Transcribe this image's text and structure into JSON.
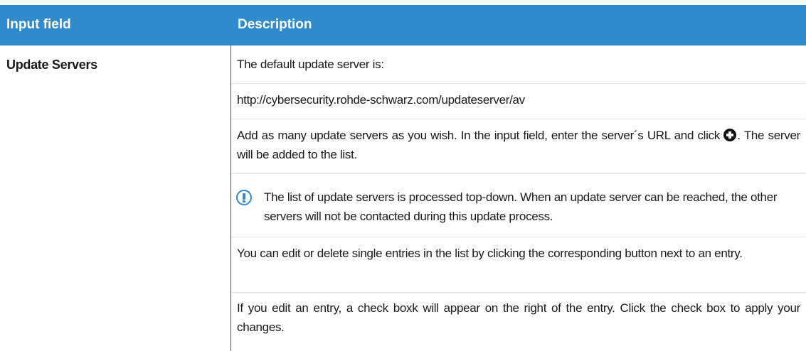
{
  "table": {
    "headers": {
      "input_field": "Input field",
      "description": "Description"
    },
    "row": {
      "label": "Update Servers",
      "paragraphs": {
        "p1": "The default update server is:",
        "url": "http://cybersecurity.rohde-schwarz.com/updateserver/av",
        "p3_before_icon": "Add as many update servers as you wish. In the input field, enter the server´s URL and click",
        "p3_after_icon": ". The server will be added to the list.",
        "note": "The list of update servers is processed top-down. When an update server can be reached, the other servers will not be contacted during this update process.",
        "p5": "You can edit or delete single entries in the list by clicking the corresponding button next to an entry.",
        "p6": "If you edit an entry, a check boxk will appear on the right of the entry. Click the check box to apply your changes."
      }
    }
  },
  "icons": {
    "add": "plus-circle-icon",
    "note": "exclamation-circle-icon"
  },
  "colors": {
    "header_bg": "#2f8bcc",
    "header_text": "#ffffff",
    "note_icon": "#2f8bcc"
  }
}
